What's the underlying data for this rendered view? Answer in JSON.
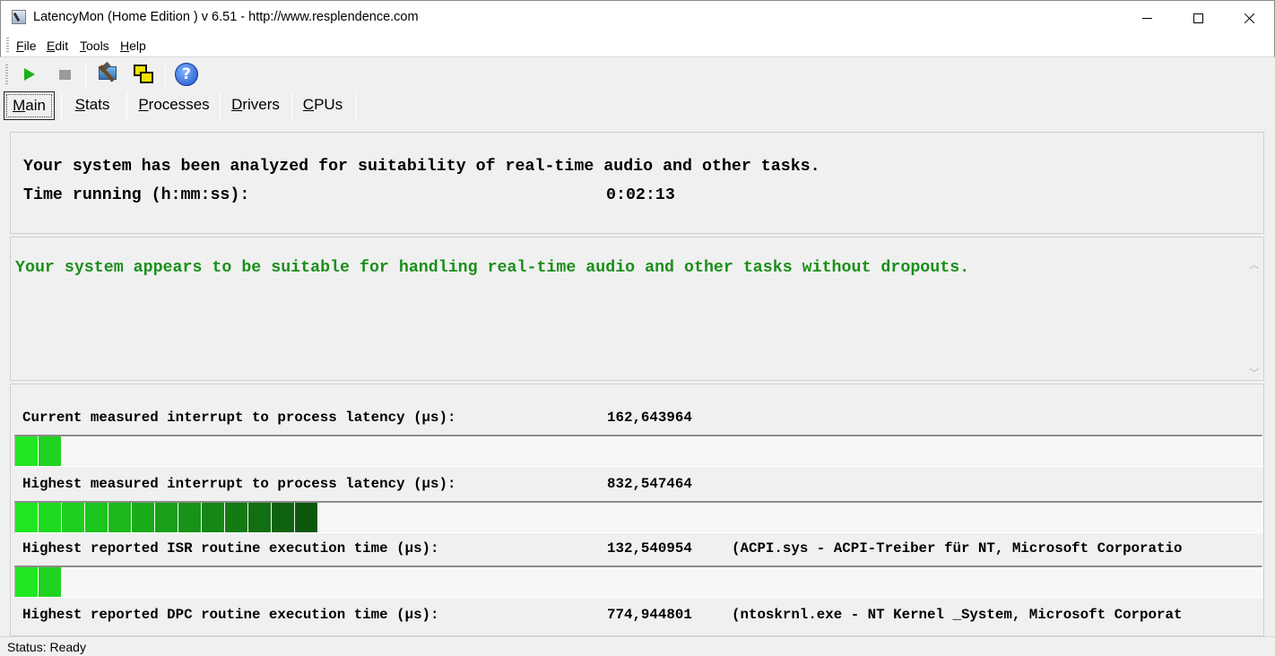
{
  "window": {
    "title": "LatencyMon  (Home Edition )  v 6.51 - http://www.resplendence.com",
    "minimize_label": "",
    "maximize_label": "",
    "close_label": ""
  },
  "menu": [
    {
      "key": "F",
      "rest": "ile"
    },
    {
      "key": "E",
      "rest": "dit"
    },
    {
      "key": "T",
      "rest": "ools"
    },
    {
      "key": "H",
      "rest": "elp"
    }
  ],
  "toolbar": {
    "icons": [
      "play-icon",
      "stop-icon",
      "tools-icon",
      "windows-icon",
      "help-icon"
    ],
    "help_glyph": "?"
  },
  "tabs": [
    {
      "key": "M",
      "rest": "ain",
      "active": true
    },
    {
      "key": "S",
      "rest": "tats",
      "active": false
    },
    {
      "key": "P",
      "rest": "rocesses",
      "active": false
    },
    {
      "key": "D",
      "rest": "rivers",
      "active": false
    },
    {
      "key": "C",
      "rest": "PUs",
      "active": false
    }
  ],
  "summary": {
    "analyzed_text": "Your system has been analyzed for suitability of real-time audio and other tasks.",
    "time_label": "Time running (h:mm:ss):",
    "time_value": "0:02:13"
  },
  "verdict": {
    "text": "Your system appears to be suitable for handling real-time audio and other tasks without dropouts.",
    "color": "#1a8f1a"
  },
  "metrics": [
    {
      "label": "Current measured interrupt to process latency (µs):",
      "value": "162,643964",
      "detail": "",
      "bar_segments": 2
    },
    {
      "label": "Highest measured interrupt to process latency (µs):",
      "value": "832,547464",
      "detail": "",
      "bar_segments": 13
    },
    {
      "label": "Highest reported ISR routine execution time (µs):",
      "value": "132,540954",
      "detail": "(ACPI.sys - ACPI-Treiber für NT, Microsoft Corporatio",
      "bar_segments": 2
    },
    {
      "label": "Highest reported DPC routine execution time (µs):",
      "value": "774,944801",
      "detail": "(ntoskrnl.exe - NT Kernel _System, Microsoft Corporat",
      "bar_segments": 0
    }
  ],
  "status": {
    "text": "Status: Ready"
  }
}
